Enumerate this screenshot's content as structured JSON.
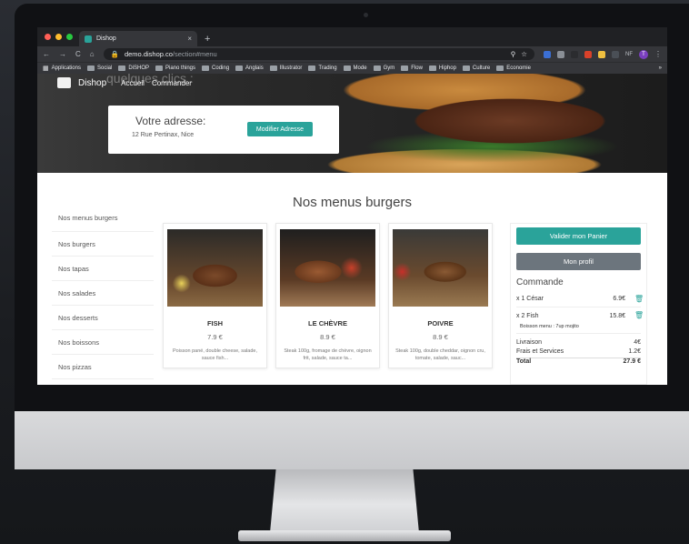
{
  "browser": {
    "tab_title": "Dishop",
    "new_tab": "+",
    "close": "×",
    "url_host": "demo.dishop.co",
    "url_path": "/section#menu",
    "avatar_letter": "T",
    "extension_label": "NF",
    "bookmarks": [
      "Applications",
      "Social",
      "DiSHOP",
      "Piano things",
      "Coding",
      "Anglais",
      "Illustrator",
      "Trading",
      "Mode",
      "Gym",
      "Flow",
      "Hiphop",
      "Culture",
      "Economie"
    ],
    "bookmarks_more": "»"
  },
  "header": {
    "faded_title": "quelques clics :",
    "brand": "Dishop",
    "nav": [
      "Accueil",
      "Commander"
    ]
  },
  "address": {
    "title": "Votre adresse:",
    "value": "12 Rue Pertinax, Nice",
    "button": "Modifier Adresse"
  },
  "section_title": "Nos menus burgers",
  "sidebar": {
    "items": [
      "Nos menus burgers",
      "Nos burgers",
      "Nos tapas",
      "Nos salades",
      "Nos desserts",
      "Nos boissons",
      "Nos pizzas"
    ]
  },
  "products": [
    {
      "name": "FISH",
      "price": "7.9 €",
      "desc": "Poisson pané, double cheese, salade, sauce fish..."
    },
    {
      "name": "LE CHÈVRE",
      "price": "8.9 €",
      "desc": "Steak 100g, fromage de chèvre, oignon frit, salade, sauce ta..."
    },
    {
      "name": "POIVRE",
      "price": "8.9 €",
      "desc": "Steak 100g, double cheddar, oignon cru, tomate, salade, sauc..."
    }
  ],
  "cart": {
    "validate": "Valider mon Panier",
    "profile": "Mon profil",
    "title": "Commande",
    "lines": [
      {
        "qty": "x 1 César",
        "price": "6.9€"
      },
      {
        "qty": "x 2 Fish",
        "price": "15.8€",
        "note": "Boisson menu : 7up mojito"
      }
    ],
    "delivery_label": "Livraison",
    "delivery_value": "4€",
    "fees_label": "Frais et Services",
    "fees_value": "1.2€",
    "total_label": "Total",
    "total_value": "27.9 €"
  },
  "colors": {
    "accent": "#2aa39a",
    "secondary": "#6c757d"
  }
}
